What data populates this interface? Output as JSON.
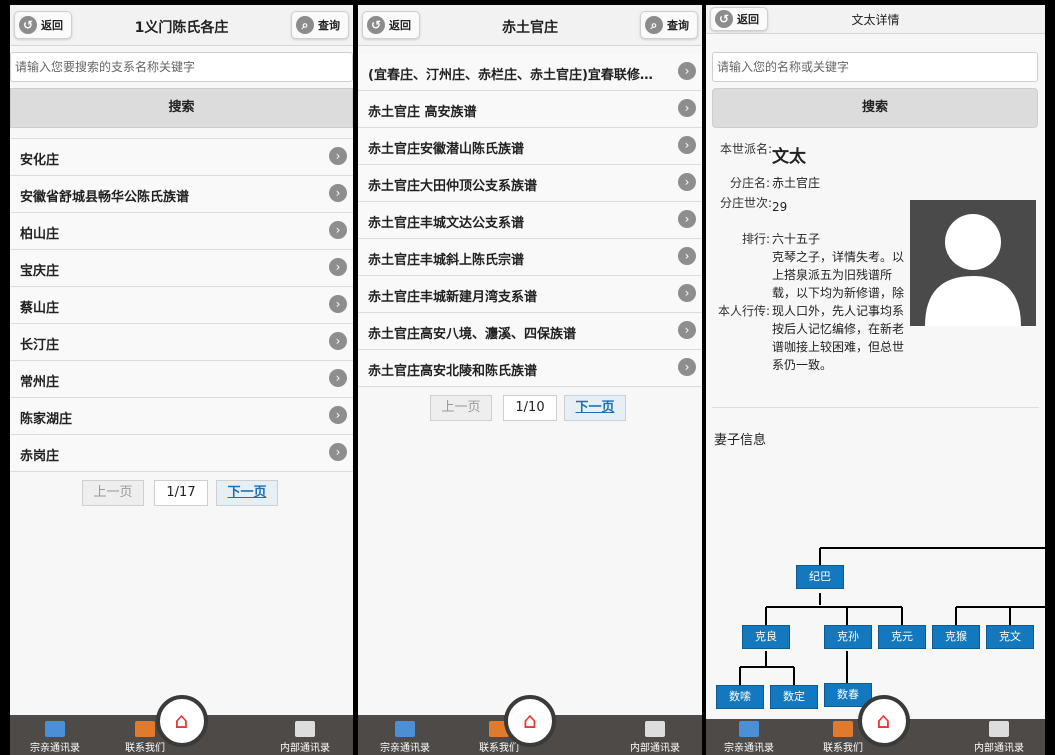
{
  "nav": {
    "back": "返回",
    "query": "查询",
    "footer": [
      "宗亲通讯录",
      "联系我们",
      "内部通讯录"
    ]
  },
  "panel1": {
    "title": "1义门陈氏各庄",
    "placeholder": "请输入您要搜索的支系名称关键字",
    "search": "搜索",
    "items": [
      "安化庄",
      "安徽省舒城县畅华公陈氏族谱",
      "柏山庄",
      "宝庆庄",
      "蔡山庄",
      "长汀庄",
      "常州庄",
      "陈家湖庄",
      "赤岗庄"
    ],
    "pager": {
      "prev": "上一页",
      "page": "1/17",
      "next": "下一页"
    }
  },
  "panel2": {
    "title": "赤土官庄",
    "items": [
      "(宜春庄、汀州庄、赤栏庄、赤土官庄)宜春联修…",
      "赤土官庄 高安族谱",
      "赤土官庄安徽潜山陈氏族谱",
      "赤土官庄大田仲顶公支系族谱",
      "赤土官庄丰城文达公支系谱",
      "赤土官庄丰城斜上陈氏宗谱",
      "赤土官庄丰城新建月湾支系谱",
      "赤土官庄高安八境、灋溪、四保族谱",
      "赤土官庄高安北陵和陈氏族谱"
    ],
    "pager": {
      "prev": "上一页",
      "page": "1/10",
      "next": "下一页"
    }
  },
  "panel3": {
    "title": "文太详情",
    "placeholder": "请输入您的名称或关键字",
    "search": "搜索",
    "labels": {
      "gen": "本世派名:",
      "branch": "分庄名:",
      "branch_gen": "分庄世次:",
      "rank": "排行:",
      "bio": "本人行传:"
    },
    "values": {
      "name": "文太",
      "branch": "赤土官庄",
      "branch_gen": "29",
      "rank": "六十五子",
      "bio": "克琴之子，详情失考。以上搭泉派五为旧残谱所载，以下均为新修谱，除现人口外，先人记事均系按后人记忆编修，在新老谱咖接上较困难，但总世系仍一致。"
    },
    "spouse": "妻子信息",
    "tree": [
      "纪巴",
      "克良",
      "克孙",
      "克元",
      "克猴",
      "克文",
      "数嗦",
      "数定",
      "数春"
    ]
  }
}
